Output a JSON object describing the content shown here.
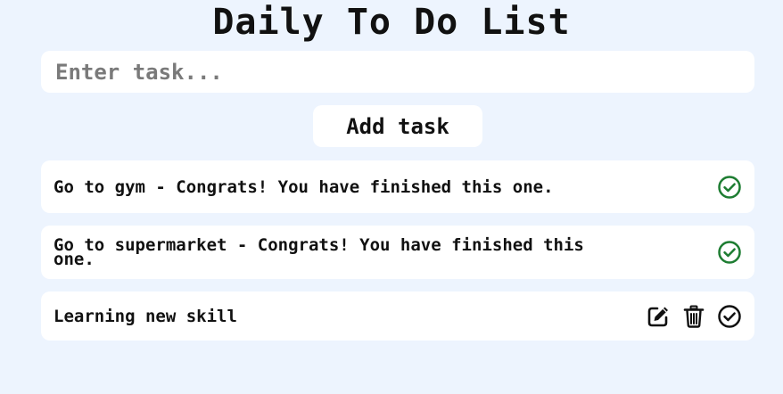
{
  "header": {
    "title": "Daily To Do List"
  },
  "form": {
    "input_placeholder": "Enter task...",
    "input_value": "",
    "add_label": "Add task"
  },
  "tasks": [
    {
      "text": "Go to gym - Congrats! You have finished this one.",
      "completed": true,
      "icons": [
        "check-circle-icon"
      ]
    },
    {
      "text": "Go to supermarket - Congrats! You have finished this one.",
      "completed": true,
      "icons": [
        "check-circle-icon"
      ]
    },
    {
      "text": "Learning new skill",
      "completed": false,
      "icons": [
        "edit-icon",
        "trash-icon",
        "check-circle-icon"
      ]
    }
  ],
  "colors": {
    "background": "#edf4fe",
    "card": "#ffffff",
    "completed_icon": "#1e7d32",
    "text": "#111111"
  }
}
